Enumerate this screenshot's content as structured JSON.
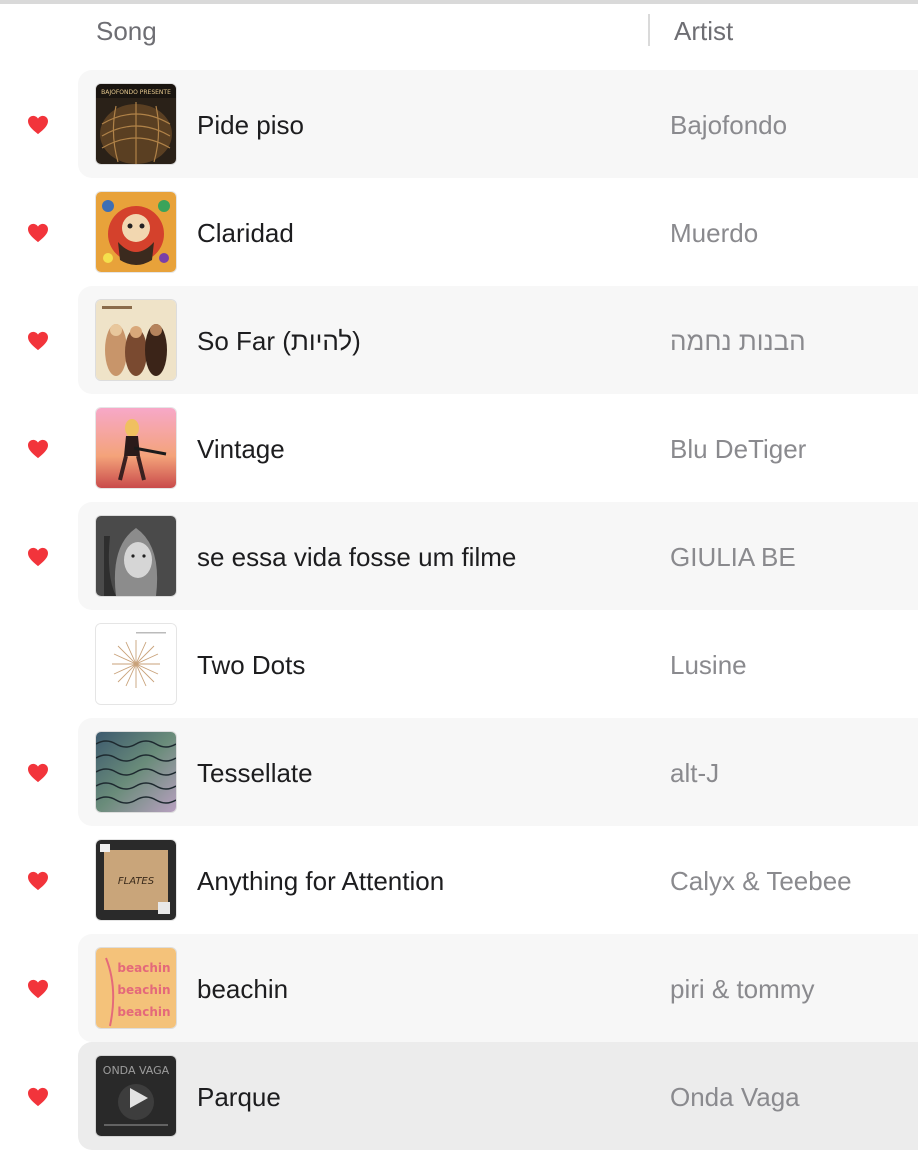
{
  "header": {
    "song_label": "Song",
    "artist_label": "Artist"
  },
  "colors": {
    "heart": "#f2343b",
    "row_alt": "#f7f7f7",
    "row_selected": "#ececec"
  },
  "songs": [
    {
      "title": "Pide piso",
      "artist": "Bajofondo",
      "loved": true,
      "art_label": "BAJOFONDO PRESENTE"
    },
    {
      "title": "Claridad",
      "artist": "Muerdo",
      "loved": true,
      "art_label": ""
    },
    {
      "title": "So Far (להיות)",
      "artist": "הבנות נחמה",
      "loved": true,
      "art_label": ""
    },
    {
      "title": "Vintage",
      "artist": "Blu DeTiger",
      "loved": true,
      "art_label": ""
    },
    {
      "title": "se essa vida fosse um filme",
      "artist": "GIULIA BE",
      "loved": true,
      "art_label": ""
    },
    {
      "title": "Two Dots",
      "artist": "Lusine",
      "loved": false,
      "art_label": ""
    },
    {
      "title": "Tessellate",
      "artist": "alt-J",
      "loved": true,
      "art_label": ""
    },
    {
      "title": "Anything for Attention",
      "artist": "Calyx & Teebee",
      "loved": true,
      "art_label": "FLATES"
    },
    {
      "title": "beachin",
      "artist": "piri & tommy",
      "loved": true,
      "art_label": "beachin"
    },
    {
      "title": "Parque",
      "artist": "Onda Vaga",
      "loved": true,
      "art_label": "ONDA VAGA"
    }
  ]
}
